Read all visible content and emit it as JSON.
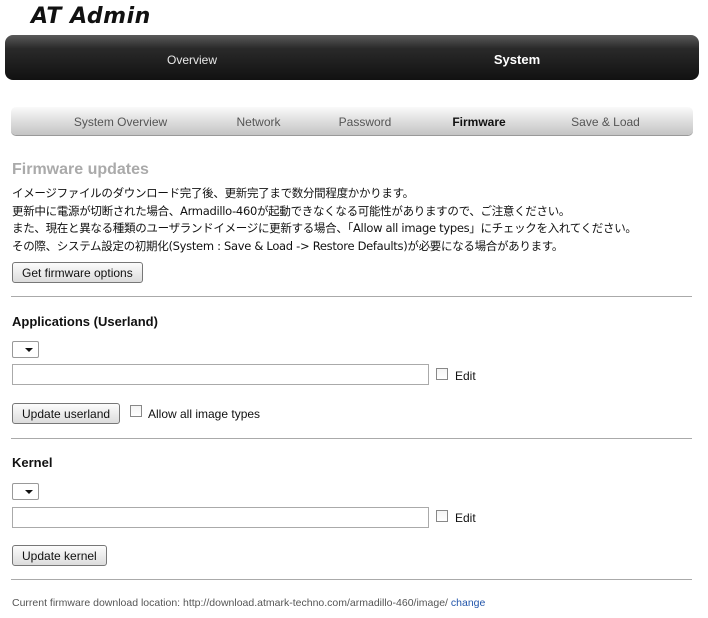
{
  "app": {
    "title": "AT Admin"
  },
  "main_nav": {
    "items": [
      {
        "label": "Overview"
      },
      {
        "label": "System",
        "active": true
      }
    ]
  },
  "sub_nav": {
    "items": [
      {
        "label": "System Overview"
      },
      {
        "label": "Network"
      },
      {
        "label": "Password"
      },
      {
        "label": "Firmware",
        "active": true
      },
      {
        "label": "Save & Load"
      }
    ]
  },
  "firmware": {
    "title": "Firmware updates",
    "description": [
      "イメージファイルのダウンロード完了後、更新完了まで数分間程度かかります。",
      "更新中に電源が切断された場合、Armadillo-460が起動できなくなる可能性がありますので、ご注意ください。",
      "また、現在と異なる種類のユーザランドイメージに更新する場合、「Allow all image types」にチェックを入れてください。",
      "その際、システム設定の初期化(System : Save & Load -> Restore Defaults)が必要になる場合があります。"
    ],
    "get_options_label": "Get firmware options"
  },
  "userland": {
    "heading": "Applications (Userland)",
    "select_value": "",
    "url_value": "",
    "edit_label": "Edit",
    "update_label": "Update userland",
    "allow_all_label": "Allow all image types"
  },
  "kernel": {
    "heading": "Kernel",
    "select_value": "",
    "url_value": "",
    "edit_label": "Edit",
    "update_label": "Update kernel"
  },
  "footer": {
    "location_text": "Current firmware download location: http://download.atmark-techno.com/armadillo-460/image/",
    "change_link": "change"
  },
  "colors": {
    "nav_bg": "#111111",
    "link": "#2255aa",
    "section_title": "#aaaaaa"
  }
}
